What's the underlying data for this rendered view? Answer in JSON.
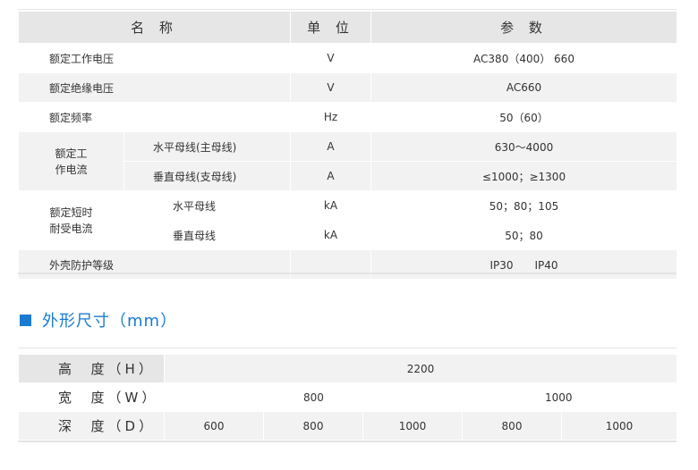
{
  "spec": {
    "headers": {
      "name": "名 称",
      "unit": "单 位",
      "param": "参 数"
    },
    "rows": [
      {
        "name": "额定工作电压",
        "unit": "V",
        "param": "AC380（400） 660"
      },
      {
        "name": "额定绝缘电压",
        "unit": "V",
        "param": "AC660"
      },
      {
        "name": "额定频率",
        "unit": "Hz",
        "param": "50（60）"
      }
    ],
    "group1": {
      "label_line1": "额定工",
      "label_line2": "作电流",
      "rows": [
        {
          "sub": "水平母线(主母线)",
          "unit": "A",
          "param": "630～4000"
        },
        {
          "sub": "垂直母线(支母线)",
          "unit": "A",
          "param": "≤1000；≥1300"
        }
      ]
    },
    "group2": {
      "label_line1": "额定短时",
      "label_line2": "耐受电流",
      "rows": [
        {
          "sub": "水平母线",
          "unit": "kA",
          "param": "50；80；105"
        },
        {
          "sub": "垂直母线",
          "unit": "kA",
          "param": "50；80"
        }
      ]
    },
    "protection": {
      "name": "外壳防护等级",
      "unit": "",
      "param": "IP30　　IP40"
    }
  },
  "section": {
    "title": "外形尺寸（mm）",
    "color": "#1a7bd1"
  },
  "dimensions": {
    "height": {
      "label": "高  度（H）",
      "value": "2200"
    },
    "width": {
      "label": "宽  度（W）",
      "values": [
        "800",
        "1000"
      ]
    },
    "depth": {
      "label": "深  度（D）",
      "values": [
        "600",
        "800",
        "1000",
        "800",
        "1000"
      ]
    }
  }
}
